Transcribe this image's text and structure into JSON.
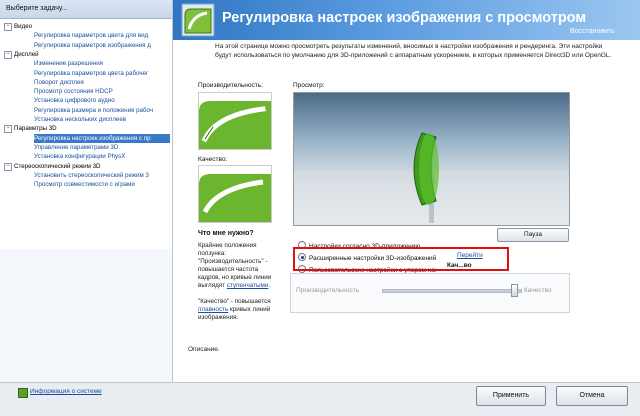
{
  "left_panel": {
    "header": "Выберите задачу...",
    "tree": [
      {
        "kind": "cat",
        "label": "Видео"
      },
      {
        "kind": "item",
        "label": "Регулировка параметров цвета для вид"
      },
      {
        "kind": "item",
        "label": "Регулировка параметров изображения д"
      },
      {
        "kind": "cat",
        "label": "Дисплей"
      },
      {
        "kind": "item",
        "label": "Изменение разрешения"
      },
      {
        "kind": "item",
        "label": "Регулировка параметров цвета рабочег"
      },
      {
        "kind": "item",
        "label": "Поворот дисплея"
      },
      {
        "kind": "item",
        "label": "Просмотр состояния HDCP"
      },
      {
        "kind": "item",
        "label": "Установка цифрового аудио"
      },
      {
        "kind": "item",
        "label": "Регулировка размера и положения рабоч"
      },
      {
        "kind": "item",
        "label": "Установка нескольких дисплеев"
      },
      {
        "kind": "cat",
        "label": "Параметры 3D"
      },
      {
        "kind": "item",
        "label": "Регулировка настроек изображения с пр",
        "selected": true
      },
      {
        "kind": "item",
        "label": "Управление параметрами 3D"
      },
      {
        "kind": "item",
        "label": "Установка конфигурации PhysX"
      },
      {
        "kind": "cat",
        "label": "Стереоскопический режим 3D"
      },
      {
        "kind": "item",
        "label": "Установить стереоскопический режим 3"
      },
      {
        "kind": "item",
        "label": "Просмотр совместимости с играми"
      }
    ]
  },
  "header": {
    "title": "Регулировка настроек изображения с просмотром",
    "restore": "Восстановить"
  },
  "main": {
    "description": "На этой странице можно просмотреть результаты изменений, вносимых в настройки изображения и рендеринга. Эти настройки будут использоваться по умолчанию для 3D-приложений с аппаратным ускорением, в которых применяется Direct3D или OpenGL.",
    "performance_label": "Производительность:",
    "quality_label": "Качество:",
    "preview_label": "Просмотр:",
    "pause_label": "Пауза",
    "option_app": "Настройки согласно 3D-приложению",
    "option_advanced": "Расширенные настройки 3D-изображений",
    "option_custom": "Пользовательские настройки с упором на:",
    "inline_link": "Перейти",
    "obscured_text": "Кач...вo",
    "slider_left": "Производительность",
    "slider_right": "Качество",
    "slider_value": 0.95,
    "help_title": "Что мне нужно?",
    "help_p1_a": "Крайние положения ползунка: \"Производительность\" - повышается частота кадров, но кривые линии выглядят ",
    "help_p1_link": "ступенчатыми",
    "help_p1_b": ".",
    "help_p2_a": "\"Качество\" - повышается ",
    "help_p2_link": "плавность",
    "help_p2_b": " кривых линий изображения.",
    "desc_label": "Описание."
  },
  "footer": {
    "sysinfo": "Информация о системе",
    "apply": "Применить",
    "cancel": "Отмена"
  }
}
